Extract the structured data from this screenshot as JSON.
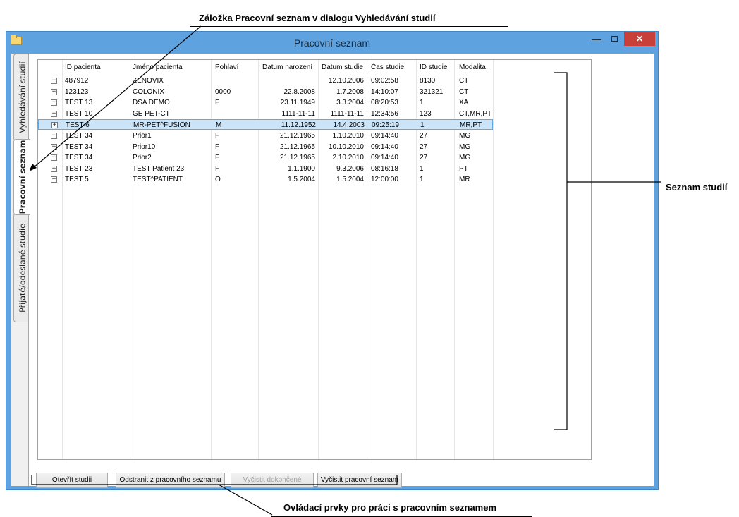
{
  "annotations": {
    "top": "Záložka Pracovní seznam v dialogu Vyhledávání studií",
    "right": "Seznam studií",
    "bottom": "Ovládací prvky pro práci s pracovním seznamem"
  },
  "window": {
    "title": "Pracovní seznam",
    "minimize": "—",
    "close": "✕"
  },
  "tabs": [
    {
      "label": "Vyhledávání studií"
    },
    {
      "label": "Pracovní seznam"
    },
    {
      "label": "Přijaté/odeslané studie"
    }
  ],
  "columns": [
    "ID pacienta",
    "Jméno pacienta",
    "Pohlaví",
    "Datum narození",
    "Datum studie",
    "Čas studie",
    "ID studie",
    "Modalita"
  ],
  "rows": [
    {
      "expander": "+",
      "id": "487912",
      "name": "ZENOVIX",
      "sex": "",
      "dob": "",
      "date": "12.10.2006",
      "time": "09:02:58",
      "study": "8130",
      "mod": "CT"
    },
    {
      "expander": "+",
      "id": "123123",
      "name": "COLONIX",
      "sex": "0000",
      "dob": "22.8.2008",
      "date": "1.7.2008",
      "time": "14:10:07",
      "study": "321321",
      "mod": "CT"
    },
    {
      "expander": "+",
      "id": "TEST 13",
      "name": "DSA DEMO",
      "sex": "F",
      "dob": "23.11.1949",
      "date": "3.3.2004",
      "time": "08:20:53",
      "study": "1",
      "mod": "XA"
    },
    {
      "expander": "+",
      "id": "TEST 10",
      "name": "GE PET-CT",
      "sex": "",
      "dob": "1111-11-11",
      "date": "1111-11-11",
      "time": "12:34:56",
      "study": "123",
      "mod": "CT,MR,PT"
    },
    {
      "expander": "+",
      "id": "TEST 6",
      "name": "MR-PET^FUSION",
      "sex": "M",
      "dob": "11.12.1952",
      "date": "14.4.2003",
      "time": "09:25:19",
      "study": "1",
      "mod": "MR,PT"
    },
    {
      "expander": "+",
      "id": "TEST 34",
      "name": "Prior1",
      "sex": "F",
      "dob": "21.12.1965",
      "date": "1.10.2010",
      "time": "09:14:40",
      "study": "27",
      "mod": "MG"
    },
    {
      "expander": "+",
      "id": "TEST 34",
      "name": "Prior10",
      "sex": "F",
      "dob": "21.12.1965",
      "date": "10.10.2010",
      "time": "09:14:40",
      "study": "27",
      "mod": "MG"
    },
    {
      "expander": "+",
      "id": "TEST 34",
      "name": "Prior2",
      "sex": "F",
      "dob": "21.12.1965",
      "date": "2.10.2010",
      "time": "09:14:40",
      "study": "27",
      "mod": "MG"
    },
    {
      "expander": "+",
      "id": "TEST 23",
      "name": "TEST Patient 23",
      "sex": "F",
      "dob": "1.1.1900",
      "date": "9.3.2006",
      "time": "08:16:18",
      "study": "1",
      "mod": "PT"
    },
    {
      "expander": "+",
      "id": "TEST 5",
      "name": "TEST^PATIENT",
      "sex": "O",
      "dob": "1.5.2004",
      "date": "1.5.2004",
      "time": "12:00:00",
      "study": "1",
      "mod": "MR"
    }
  ],
  "buttons": {
    "open": "Otevřít studii",
    "remove": "Odstranit z pracovního seznamu",
    "clear_done": "Vyčistit dokončené",
    "clear_all": "Vyčistit pracovní seznam"
  }
}
